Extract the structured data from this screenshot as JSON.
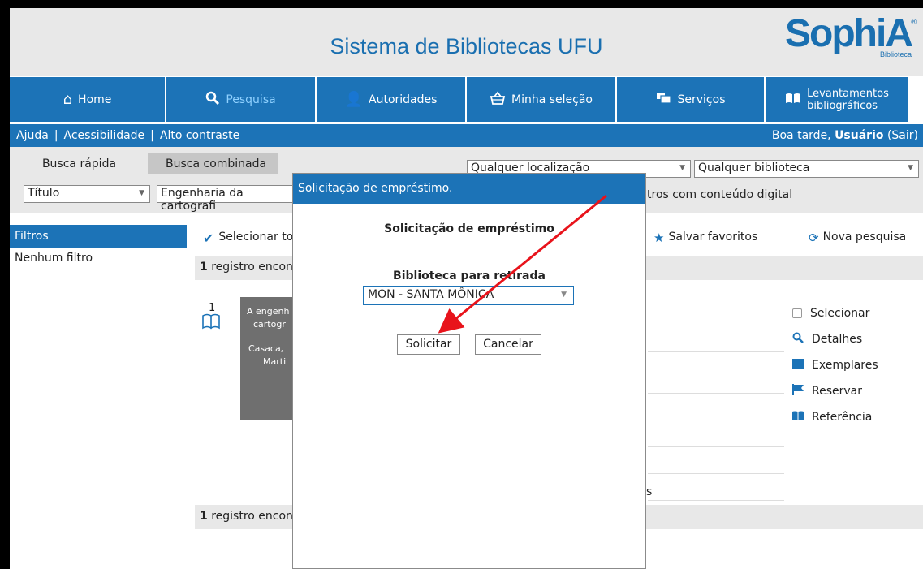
{
  "header": {
    "title": "Sistema de Bibliotecas UFU",
    "logo": "SophiA",
    "logo_sub": "Biblioteca",
    "logo_reg": "®"
  },
  "nav": {
    "home": "Home",
    "pesquisa": "Pesquisa",
    "autoridades": "Autoridades",
    "minha_selecao": "Minha seleção",
    "servicos": "Serviços",
    "levantamentos_1": "Levantamentos",
    "levantamentos_2": "bibliográficos"
  },
  "subbar": {
    "ajuda": "Ajuda",
    "acessibilidade": "Acessibilidade",
    "alto_contraste": "Alto contraste",
    "greeting": "Boa tarde,",
    "user": "Usuário",
    "sair": "(Sair)"
  },
  "search": {
    "tab_rapida": "Busca rápida",
    "tab_combinada": "Busca combinada",
    "localizacao": "Qualquer localização",
    "biblioteca": "Qualquer biblioteca",
    "campo": "Título",
    "termo": "Engenharia da cartografi",
    "digital": "tros com conteúdo digital"
  },
  "filters": {
    "title": "Filtros",
    "none": "Nenhum filtro"
  },
  "toolbar": {
    "selecionar": "Selecionar to",
    "salvar": "Salvar favoritos",
    "nova": "Nova pesquisa"
  },
  "results": {
    "count": "1",
    "text": "registro encont",
    "extra": "s"
  },
  "record": {
    "index": "1",
    "cover_1": "A engenh",
    "cover_2": "cartogr",
    "cover_3": "Casaca,",
    "cover_4": "Marti"
  },
  "actions": {
    "selecionar": "Selecionar",
    "detalhes": "Detalhes",
    "exemplares": "Exemplares",
    "reservar": "Reservar",
    "referencia": "Referência"
  },
  "modal": {
    "window_title": "Solicitação de empréstimo.",
    "heading": "Solicitação de empréstimo",
    "label": "Biblioteca para retirada",
    "selected": "MON - SANTA MÔNICA",
    "solicitar": "Solicitar",
    "cancelar": "Cancelar"
  },
  "colors": {
    "primary": "#1c73b7",
    "annotation": "#e8131b"
  }
}
